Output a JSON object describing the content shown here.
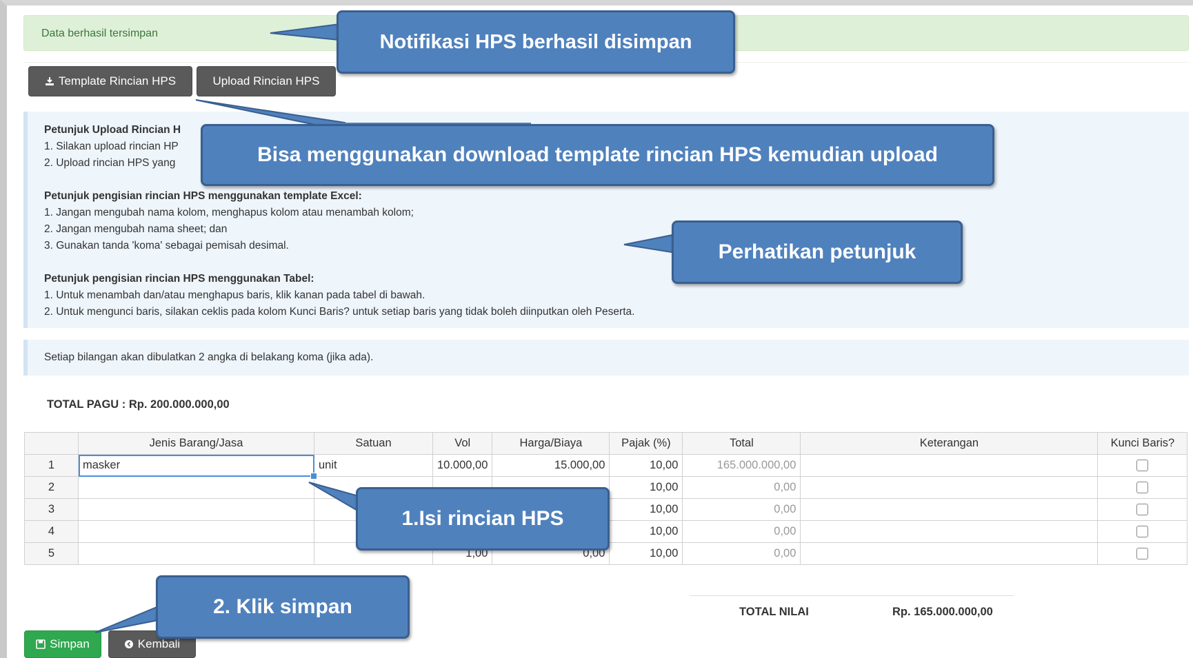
{
  "alert": {
    "text": "Data berhasil tersimpan"
  },
  "toolbar": {
    "template_label": "Template Rincian HPS",
    "upload_label": "Upload Rincian HPS"
  },
  "instructions": {
    "upload_title": "Petunjuk Upload Rincian H",
    "upload_items": [
      "1. Silakan upload rincian HP",
      "2. Upload rincian HPS yang"
    ],
    "excel_title": "Petunjuk pengisian rincian HPS menggunakan template Excel:",
    "excel_items": [
      "1. Jangan mengubah nama kolom, menghapus kolom atau menambah kolom;",
      "2. Jangan mengubah nama sheet; dan",
      "3. Gunakan tanda 'koma' sebagai pemisah desimal."
    ],
    "table_title": "Petunjuk pengisian rincian HPS menggunakan Tabel:",
    "table_items": [
      "1. Untuk menambah dan/atau menghapus baris, klik kanan pada tabel di bawah.",
      "2. Untuk mengunci baris, silakan ceklis pada kolom Kunci Baris? untuk setiap baris yang tidak boleh diinputkan oleh Peserta."
    ]
  },
  "rounding_note": "Setiap bilangan akan dibulatkan 2 angka di belakang koma (jika ada).",
  "total_pagu": "TOTAL PAGU : Rp. 200.000.000,00",
  "table": {
    "headers": [
      "",
      "Jenis Barang/Jasa",
      "Satuan",
      "Vol",
      "Harga/Biaya",
      "Pajak (%)",
      "Total",
      "Keterangan",
      "Kunci Baris?"
    ],
    "rows": [
      {
        "no": "1",
        "jenis": "masker",
        "satuan": "unit",
        "vol": "10.000,00",
        "harga": "15.000,00",
        "pajak": "10,00",
        "total": "165.000.000,00",
        "ket": ""
      },
      {
        "no": "2",
        "jenis": "",
        "satuan": "",
        "vol": "",
        "harga": "",
        "pajak": "10,00",
        "total": "0,00",
        "ket": ""
      },
      {
        "no": "3",
        "jenis": "",
        "satuan": "",
        "vol": "",
        "harga": "",
        "pajak": "10,00",
        "total": "0,00",
        "ket": ""
      },
      {
        "no": "4",
        "jenis": "",
        "satuan": "",
        "vol": "",
        "harga": "",
        "pajak": "10,00",
        "total": "0,00",
        "ket": ""
      },
      {
        "no": "5",
        "jenis": "",
        "satuan": "",
        "vol": "1,00",
        "harga": "0,00",
        "pajak": "10,00",
        "total": "0,00",
        "ket": ""
      }
    ]
  },
  "total_nilai": {
    "label": "TOTAL NILAI",
    "value": "Rp. 165.000.000,00"
  },
  "actions": {
    "save_label": "Simpan",
    "back_label": "Kembali"
  },
  "callouts": {
    "notif": "Notifikasi HPS berhasil disimpan",
    "template": "Bisa menggunakan download template rincian HPS kemudian upload",
    "petunjuk": "Perhatikan petunjuk",
    "isi": "1.Isi rincian HPS",
    "simpan": "2. Klik simpan"
  },
  "colors": {
    "callout": "#4f81bd",
    "success_bg": "#dff0d8",
    "save_button": "#2fa84f",
    "dark_button": "#5a5a5a"
  }
}
